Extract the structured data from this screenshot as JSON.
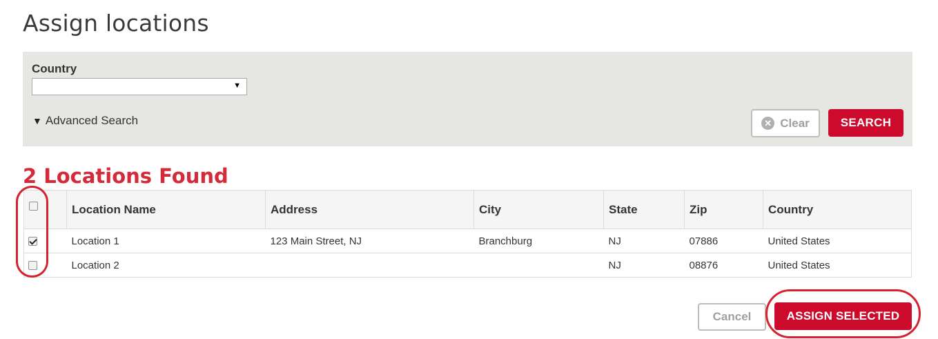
{
  "page": {
    "title": "Assign locations"
  },
  "search": {
    "country_label": "Country",
    "country_value": "",
    "country_caret": "▼",
    "advanced_toggle_icon": "▼",
    "advanced_label": "Advanced Search",
    "clear_icon": "✕",
    "clear_label": "Clear",
    "search_label": "SEARCH"
  },
  "results": {
    "heading": "2 Locations Found",
    "columns": [
      "Location Name",
      "Address",
      "City",
      "State",
      "Zip",
      "Country"
    ],
    "select_all_checked": false,
    "rows": [
      {
        "checked": true,
        "name": "Location 1",
        "address": "123 Main Street, NJ",
        "city": "Branchburg",
        "state": "NJ",
        "zip": "07886",
        "country": "United States"
      },
      {
        "checked": false,
        "name": "Location 2",
        "address": "",
        "city": "",
        "state": "NJ",
        "zip": "08876",
        "country": "United States"
      }
    ]
  },
  "actions": {
    "cancel_label": "Cancel",
    "assign_label": "ASSIGN SELECTED"
  },
  "colors": {
    "brand_red": "#cc0a2b",
    "heading_red": "#d42a3a",
    "annotation_red": "#d4222f",
    "panel_bg": "#e6e6e2"
  }
}
